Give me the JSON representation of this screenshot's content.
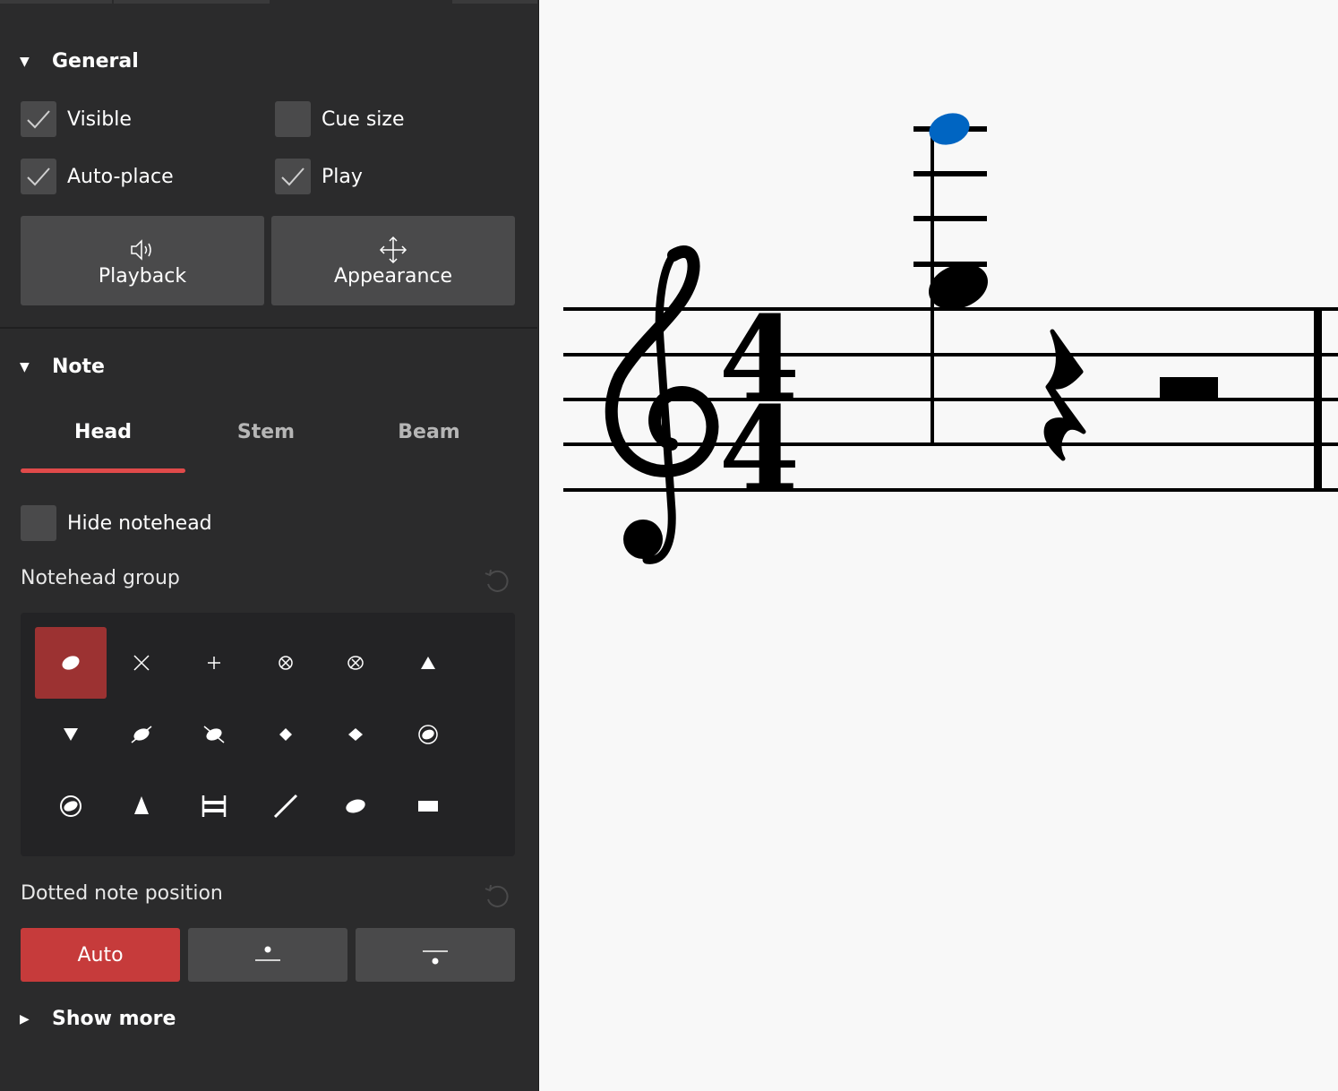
{
  "general": {
    "title": "General",
    "checkboxes": {
      "visible": {
        "label": "Visible",
        "checked": true
      },
      "cue_size": {
        "label": "Cue size",
        "checked": false
      },
      "auto_place": {
        "label": "Auto-place",
        "checked": true
      },
      "play": {
        "label": "Play",
        "checked": true
      }
    },
    "buttons": {
      "playback": {
        "label": "Playback",
        "icon": "speaker-icon"
      },
      "appearance": {
        "label": "Appearance",
        "icon": "move-arrows-icon"
      }
    }
  },
  "note": {
    "title": "Note",
    "tabs": [
      {
        "label": "Head",
        "active": true
      },
      {
        "label": "Stem",
        "active": false
      },
      {
        "label": "Beam",
        "active": false
      }
    ],
    "hide_notehead": {
      "label": "Hide notehead",
      "checked": false
    },
    "notehead_group_label": "Notehead group",
    "notehead_groups": [
      "normal-notehead-icon",
      "cross-notehead-icon",
      "plus-notehead-icon",
      "circled-x-notehead-icon",
      "with-x-notehead-icon",
      "triangle-up-notehead-icon",
      "triangle-down-notehead-icon",
      "slashed-forwards-notehead-icon",
      "slashed-backwards-notehead-icon",
      "diamond-notehead-icon",
      "diamond-old-notehead-icon",
      "circled-notehead-icon",
      "circled-large-notehead-icon",
      "large-arrow-up-notehead-icon",
      "brevis-alt-notehead-icon",
      "slash-notehead-icon",
      "large-diamond-notehead-icon",
      "rectangle-notehead-icon"
    ],
    "selected_notehead": "normal-notehead-icon",
    "dotted_position_label": "Dotted note position",
    "dotted_options": [
      {
        "label": "Auto",
        "active": true
      },
      {
        "label": "",
        "icon": "dot-above-icon",
        "active": false
      },
      {
        "label": "",
        "icon": "dot-below-icon",
        "active": false
      }
    ]
  },
  "show_more": {
    "label": "Show more"
  },
  "colors": {
    "accent": "#e04a4a",
    "selected_cell": "#9c3232",
    "selected_note": "#0065c2",
    "panel_bg": "#2b2b2c",
    "score_bg": "#f8f8f8"
  }
}
